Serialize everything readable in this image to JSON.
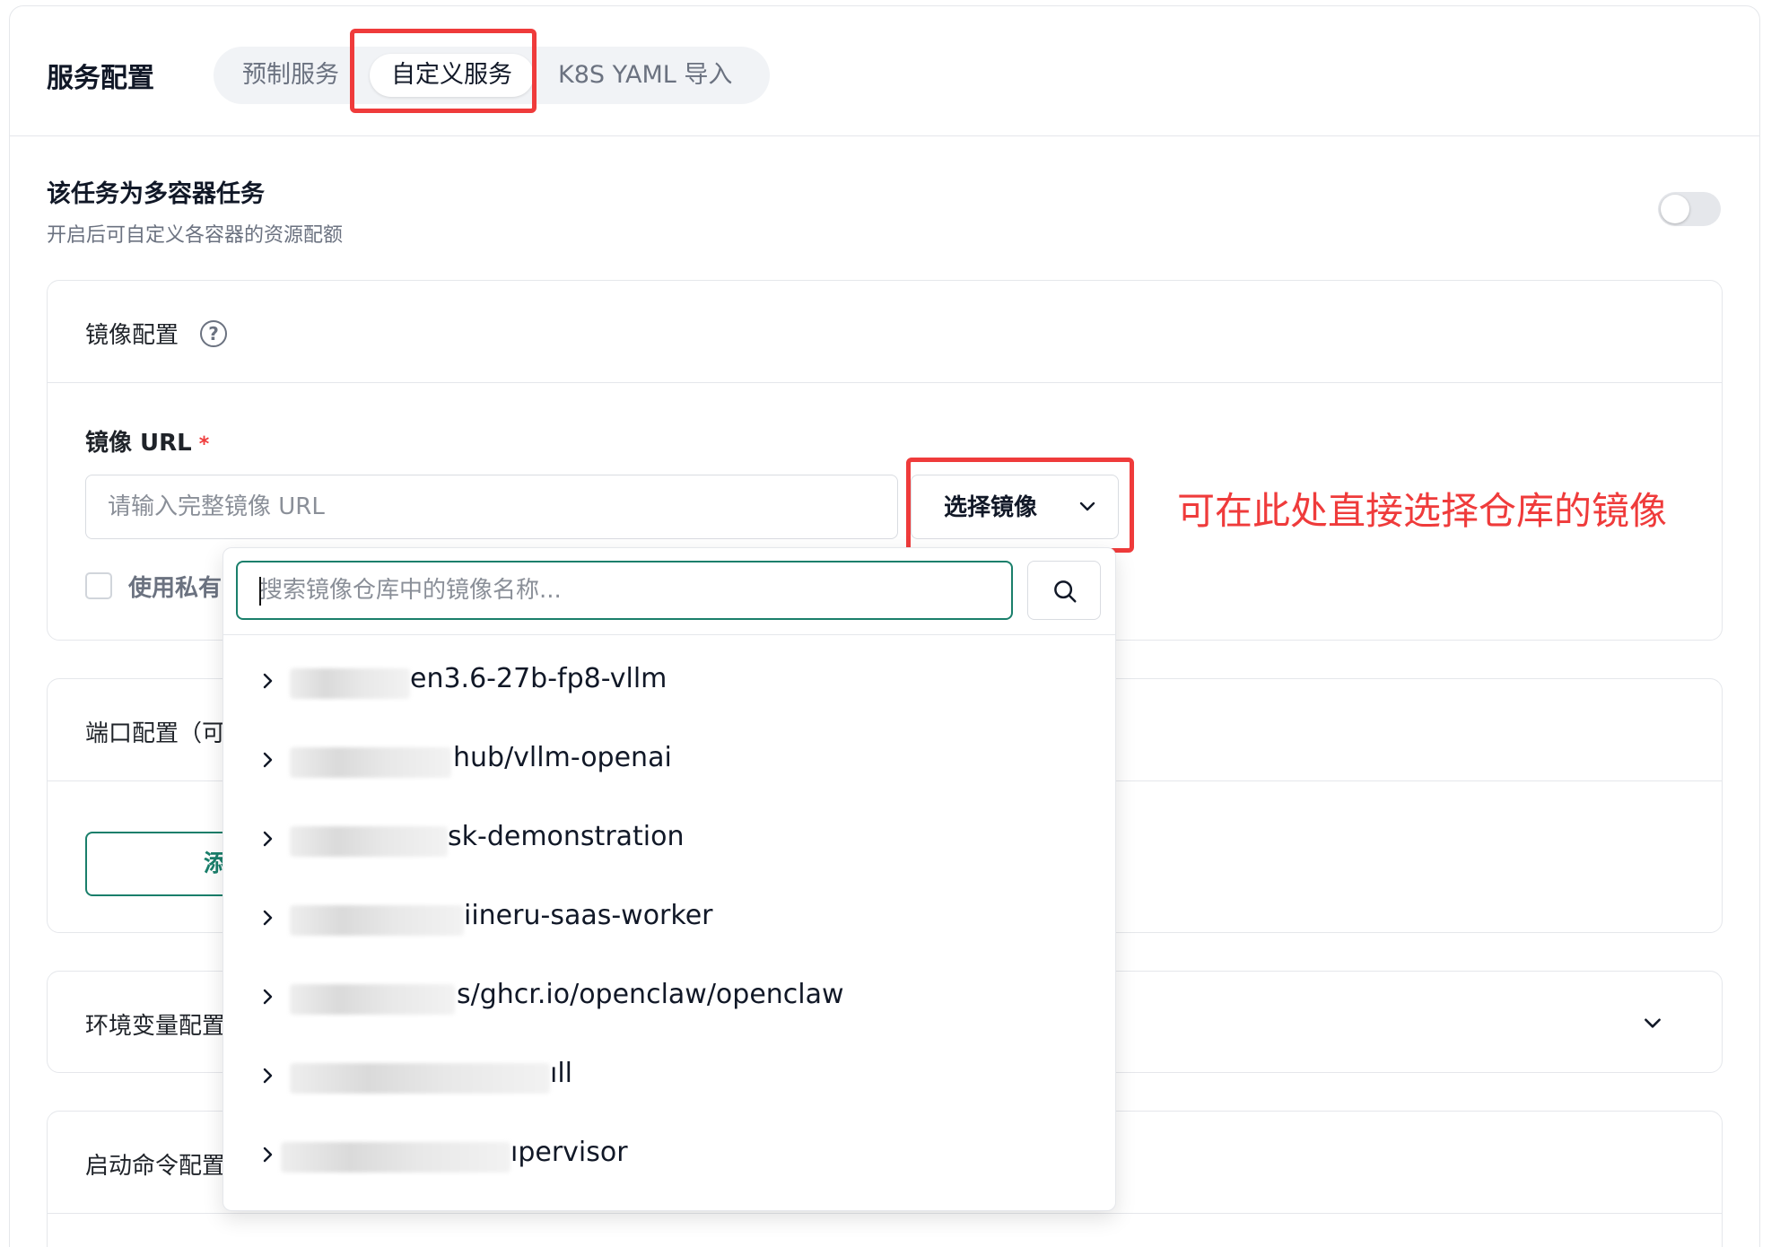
{
  "header": {
    "title": "服务配置",
    "tabs": [
      "预制服务",
      "自定义服务",
      "K8S YAML 导入"
    ],
    "active_tab": "自定义服务"
  },
  "multi_container": {
    "title": "该任务为多容器任务",
    "description": "开启后可自定义各容器的资源配额",
    "enabled": false
  },
  "image_section": {
    "title": "镜像配置",
    "url_label": "镜像 URL",
    "required_mark": "*",
    "url_placeholder": "请输入完整镜像 URL",
    "select_button": "选择镜像",
    "private_label": "使用私有"
  },
  "annotation": "可在此处直接选择仓库的镜像",
  "dropdown": {
    "search_placeholder": "搜索镜像仓库中的镜像名称...",
    "items": [
      "en3.6-27b-fp8-vllm",
      "hub/vllm-openai",
      "sk-demonstration",
      "iineru-saas-worker",
      "s/ghcr.io/openclaw/openclaw",
      "ıll",
      "ıpervisor"
    ]
  },
  "port_section": {
    "title": "端口配置（可",
    "add_button": "添"
  },
  "env_section": {
    "title": "环境变量配置"
  },
  "cmd_section": {
    "title": "启动命令配置"
  },
  "colors": {
    "accent": "#1a7f6b",
    "highlight": "#ef3b3b"
  }
}
